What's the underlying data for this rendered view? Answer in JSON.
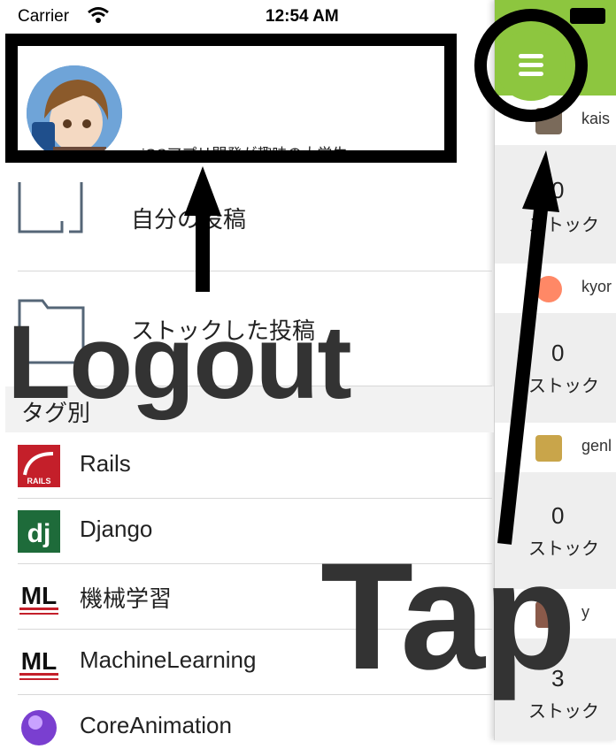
{
  "status_bar": {
    "carrier": "Carrier",
    "time": "12:54 AM"
  },
  "profile": {
    "bio": "iOSアプリ開発が趣味の大学生"
  },
  "menu": {
    "my_posts": "自分の投稿",
    "stocked_posts": "ストックした投稿"
  },
  "tags": {
    "header": "タグ別",
    "items": [
      {
        "label": "Rails",
        "icon": "rails-icon"
      },
      {
        "label": "Django",
        "icon": "django-icon"
      },
      {
        "label": "機械学習",
        "icon": "machine-learning-icon"
      },
      {
        "label": "MachineLearning",
        "icon": "machine-learning-icon"
      },
      {
        "label": "CoreAnimation",
        "icon": "core-animation-icon"
      }
    ]
  },
  "feed": {
    "users": [
      "kais",
      "kyor",
      "genl",
      "y"
    ],
    "stocks": [
      {
        "count": "0",
        "label": "ストック"
      },
      {
        "count": "0",
        "label": "ストック"
      },
      {
        "count": "0",
        "label": "ストック"
      },
      {
        "count": "3",
        "label": "ストック"
      }
    ]
  },
  "annotations": {
    "logout": "Logout",
    "tap": "Tap"
  },
  "colors": {
    "menu_button": "#8dc63f",
    "overlay_text": "#333333",
    "annotation": "#000000"
  }
}
